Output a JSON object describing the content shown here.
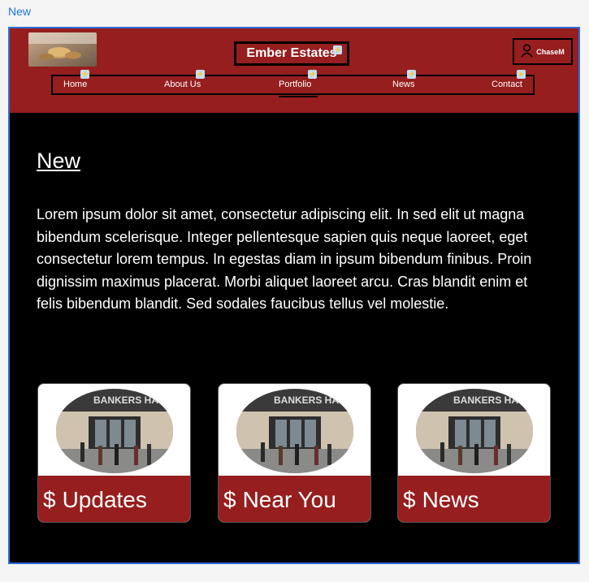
{
  "frame_label": "New",
  "header": {
    "brand": "Ember Estates",
    "user_name": "ChaseM",
    "nav": [
      "Home",
      "About Us",
      "Portfolio",
      "News",
      "Contact"
    ],
    "background": "#961e1e"
  },
  "main": {
    "title": "New",
    "body": "Lorem ipsum dolor sit amet, consectetur adipiscing elit. In sed elit ut magna bibendum scelerisque. Integer pellentesque sapien quis neque laoreet, eget consectetur lorem tempus. In egestas diam in ipsum bibendum finibus. Proin dignissim maximus placerat. Morbi aliquet laoreet arcu. Cras blandit enim et felis bibendum blandit. Sed sodales faucibus tellus vel molestie."
  },
  "cards": [
    {
      "label": "Updates",
      "icon": "dollar-icon",
      "sign_text": "BANKERS HA"
    },
    {
      "label": "Near You",
      "icon": "dollar-icon",
      "sign_text": "BANKERS HA"
    },
    {
      "label": "News",
      "icon": "dollar-icon",
      "sign_text": "BANKERS HA"
    }
  ]
}
